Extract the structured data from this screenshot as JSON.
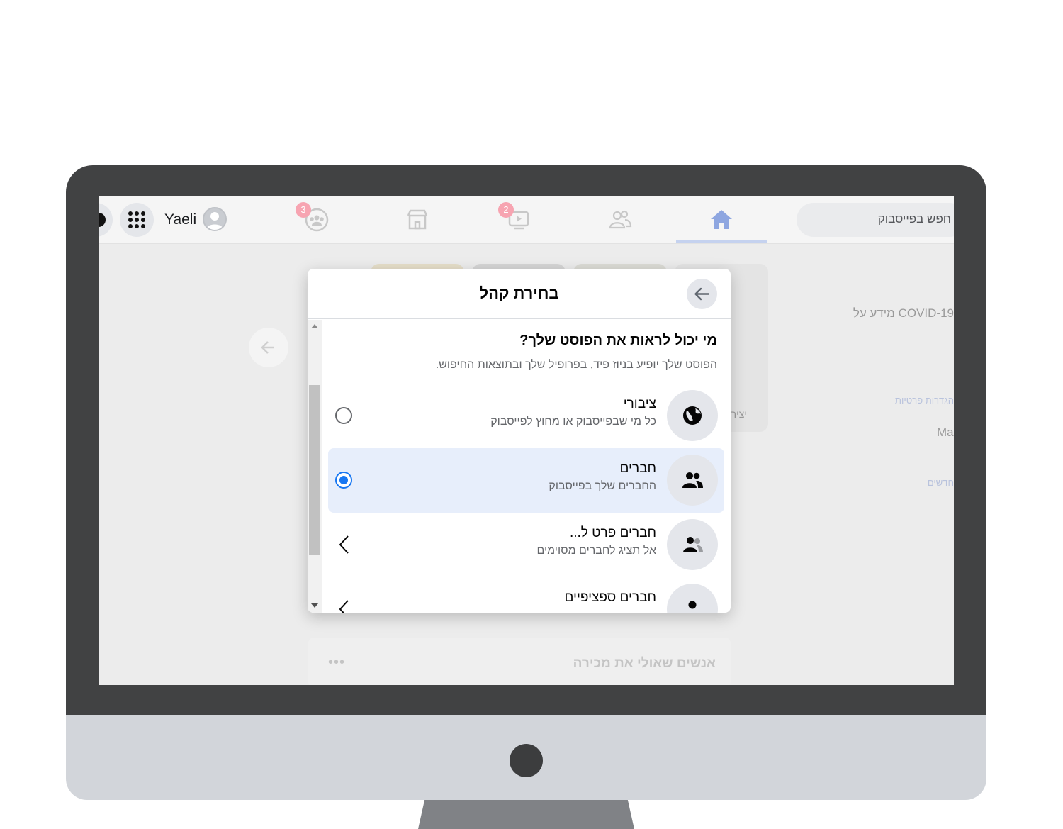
{
  "topbar": {
    "profile_name": "Yaeli",
    "groups_badge": "3",
    "watch_badge": "2",
    "search_text": "חפש בפייסבוק"
  },
  "background": {
    "right_text_1": "COVID-19 מידע על",
    "right_text_2": "Ma",
    "right_text_3": "הגדרות פרטיות",
    "right_text_4": "חדשים",
    "story_create_label": "יצירת",
    "people_you_may_know": "אנשים שאולי את מכירה"
  },
  "modal": {
    "title": "בחירת קהל",
    "question": "מי יכול לראות את הפוסט שלך?",
    "description": "הפוסט שלך יופיע בניוז פיד, בפרופיל שלך ובתוצאות החיפוש.",
    "options": [
      {
        "label": "ציבורי",
        "sub": "כל מי שבפייסבוק או מחוץ לפייסבוק",
        "icon": "globe-icon",
        "control": "radio",
        "selected": false
      },
      {
        "label": "חברים",
        "sub": "החברים שלך בפייסבוק",
        "icon": "friends-icon",
        "control": "radio",
        "selected": true
      },
      {
        "label": "חברים פרט ל...",
        "sub": "אל תציג לחברים מסוימים",
        "icon": "friends-except-icon",
        "control": "chevron",
        "selected": false
      },
      {
        "label": "חברים ספציפיים",
        "sub": "",
        "icon": "person-icon",
        "control": "chevron",
        "selected": false
      }
    ]
  },
  "colors": {
    "accent": "#1877f2",
    "selected_row": "#e7eefb",
    "bezel": "#414243"
  }
}
